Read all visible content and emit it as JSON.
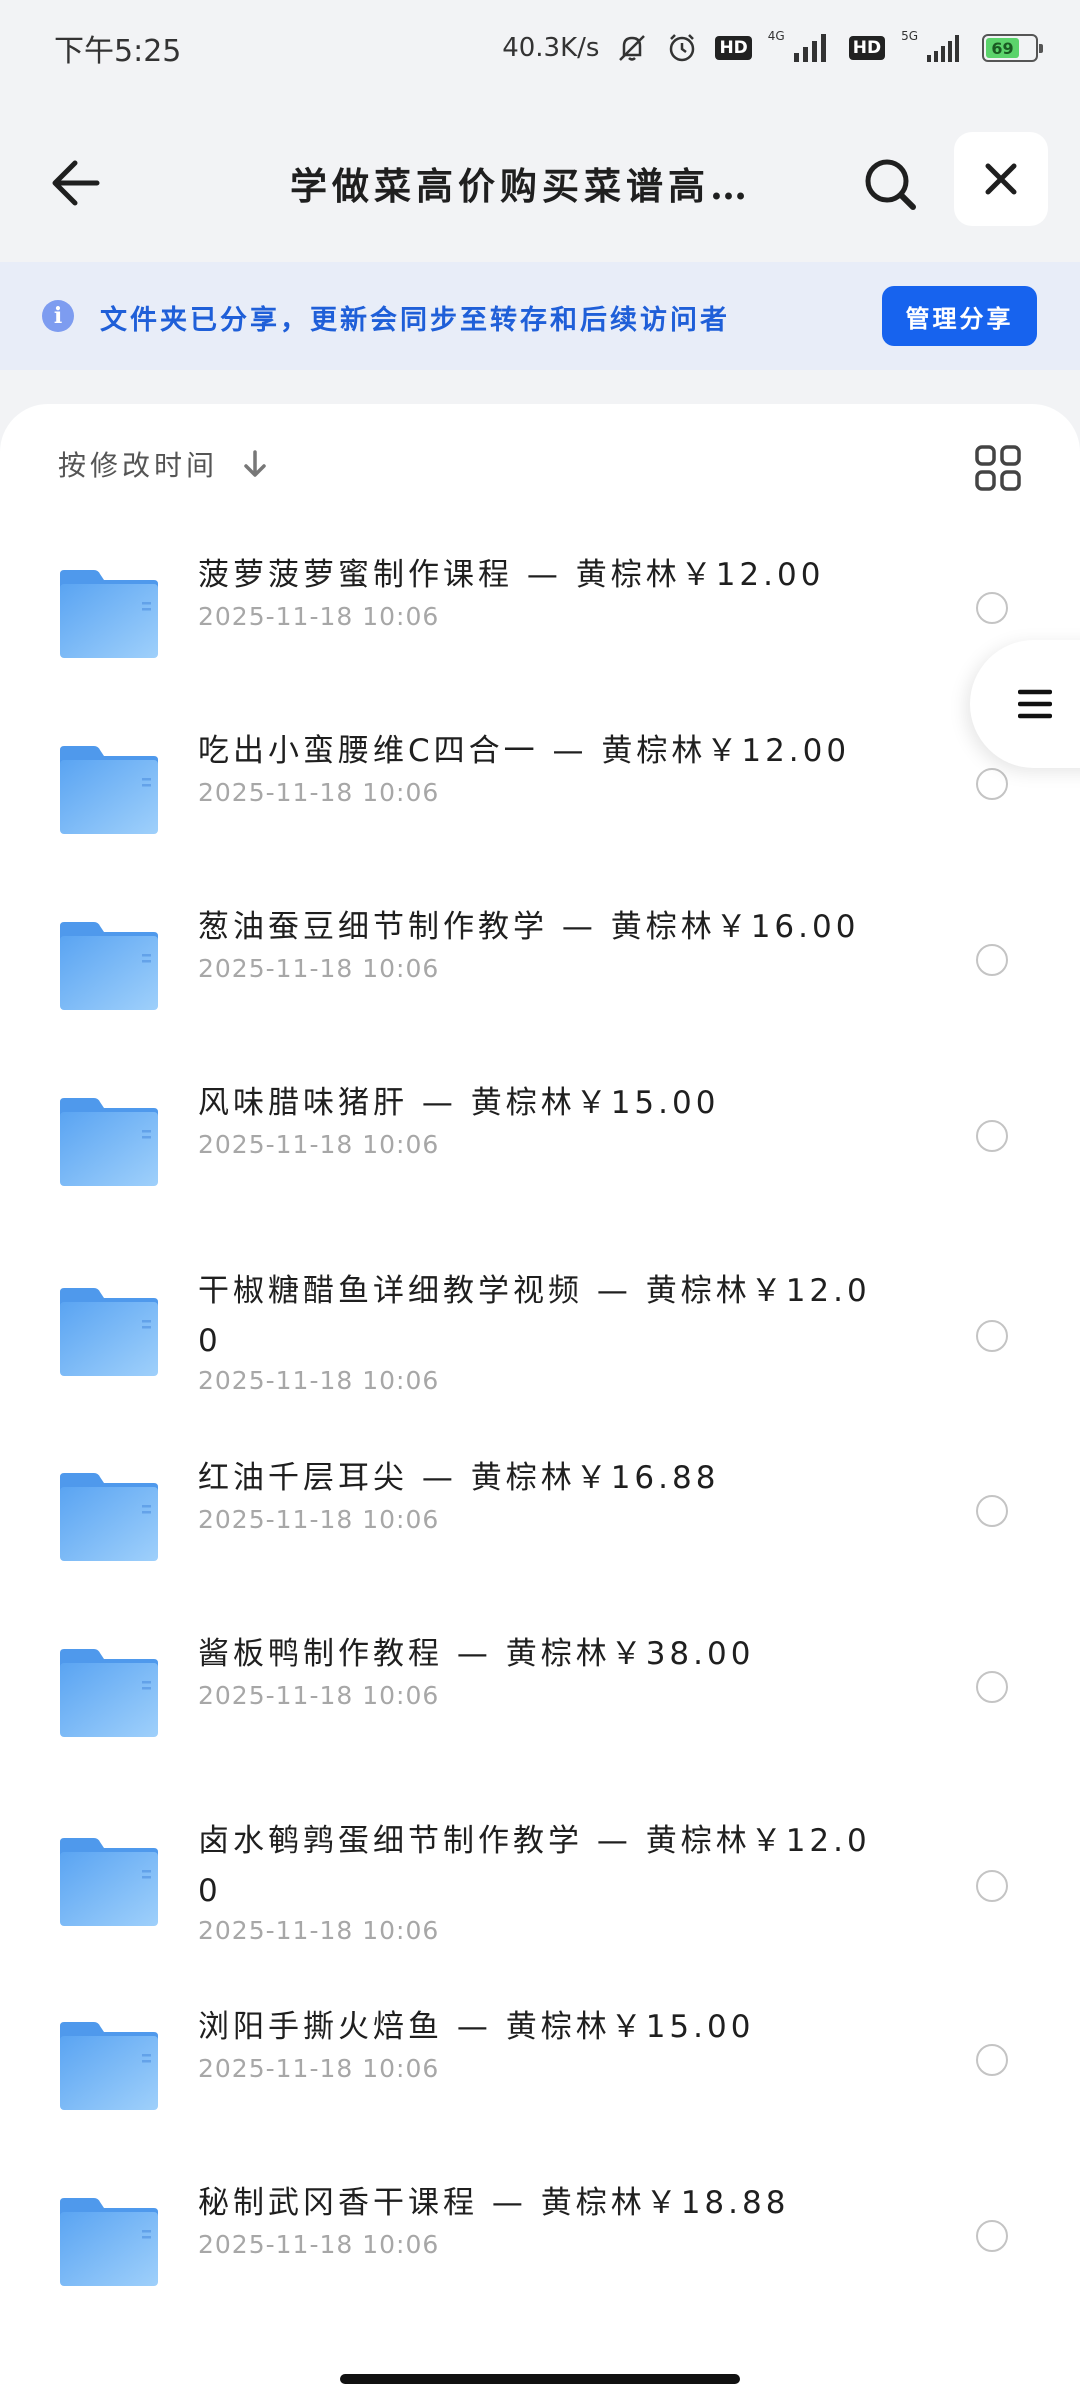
{
  "status_bar": {
    "time": "下午5:25",
    "net_speed": "40.3K/s",
    "hd1": "HD",
    "hd2": "HD",
    "net1": "4G",
    "net2": "5G",
    "battery": "69",
    "battery_level": 0.69
  },
  "nav": {
    "title": "学做菜高价购买菜谱高…",
    "back_icon": "arrow-left-icon",
    "search_icon": "search-icon",
    "close_icon": "close-icon"
  },
  "share_banner": {
    "text": "文件夹已分享，更新会同步至转存和后续访问者",
    "button": "管理分享",
    "info_icon": "info-icon"
  },
  "sort": {
    "label": "按修改时间",
    "icon": "arrow-down-icon",
    "view_icon": "grid-view-icon"
  },
  "files": [
    {
      "name": "菠萝菠萝蜜制作课程 — 黄棕林￥12.00",
      "date": "2025-11-18  10:06"
    },
    {
      "name": "吃出小蛮腰维C四合一 — 黄棕林￥12.00",
      "date": "2025-11-18  10:06"
    },
    {
      "name": "葱油蚕豆细节制作教学 — 黄棕林￥16.00",
      "date": "2025-11-18  10:06"
    },
    {
      "name": "风味腊味猪肝 — 黄棕林￥15.00",
      "date": "2025-11-18  10:06"
    },
    {
      "name": "干椒糖醋鱼详细教学视频 — 黄棕林￥12.00",
      "date": "2025-11-18  10:06"
    },
    {
      "name": "红油千层耳尖 — 黄棕林￥16.88",
      "date": "2025-11-18  10:06"
    },
    {
      "name": "酱板鸭制作教程 — 黄棕林￥38.00",
      "date": "2025-11-18  10:06"
    },
    {
      "name": "卤水鹌鹑蛋细节制作教学 — 黄棕林￥12.00",
      "date": "2025-11-18  10:06"
    },
    {
      "name": "浏阳手撕火焙鱼 — 黄棕林￥15.00",
      "date": "2025-11-18  10:06"
    },
    {
      "name": "秘制武冈香干课程 — 黄棕林￥18.88",
      "date": "2025-11-18  10:06"
    }
  ],
  "colors": {
    "accent": "#1763ee",
    "banner_bg": "#e8edf8",
    "banner_text": "#1f5fd8",
    "folder": "#6fb2f5"
  }
}
